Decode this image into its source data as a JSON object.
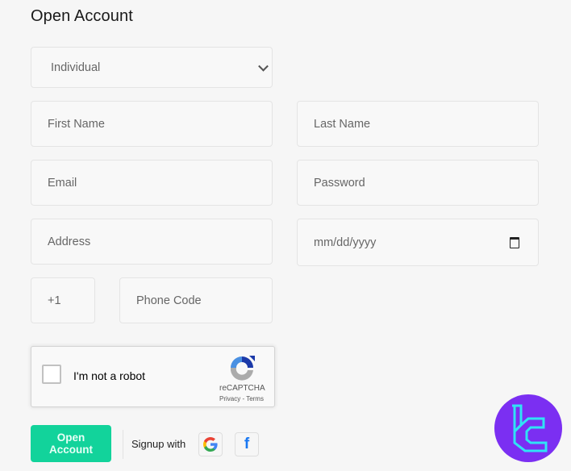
{
  "page": {
    "title": "Open Account"
  },
  "form": {
    "account_type": {
      "selected": "Individual"
    },
    "first_name": {
      "placeholder": "First Name"
    },
    "last_name": {
      "placeholder": "Last Name"
    },
    "email": {
      "placeholder": "Email"
    },
    "password": {
      "placeholder": "Password"
    },
    "address": {
      "placeholder": "Address"
    },
    "birth_date": {
      "placeholder": "mm/dd/yyyy"
    },
    "country_code": {
      "value": "+1"
    },
    "phone": {
      "placeholder": "Phone Code"
    }
  },
  "captcha": {
    "label": "I'm not a robot",
    "brand": "reCAPTCHA",
    "links": "Privacy - Terms",
    "checked": false
  },
  "actions": {
    "submit_label": "Open Account",
    "signup_with_label": "Signup with",
    "social": [
      {
        "name": "Google",
        "icon": "google-icon"
      },
      {
        "name": "Facebook",
        "icon": "facebook-icon",
        "glyph": "f"
      }
    ]
  },
  "colors": {
    "accent": "#12d39b",
    "brand_badge_bg": "#7b2ff2",
    "brand_badge_fg": "#2fe3f5"
  }
}
